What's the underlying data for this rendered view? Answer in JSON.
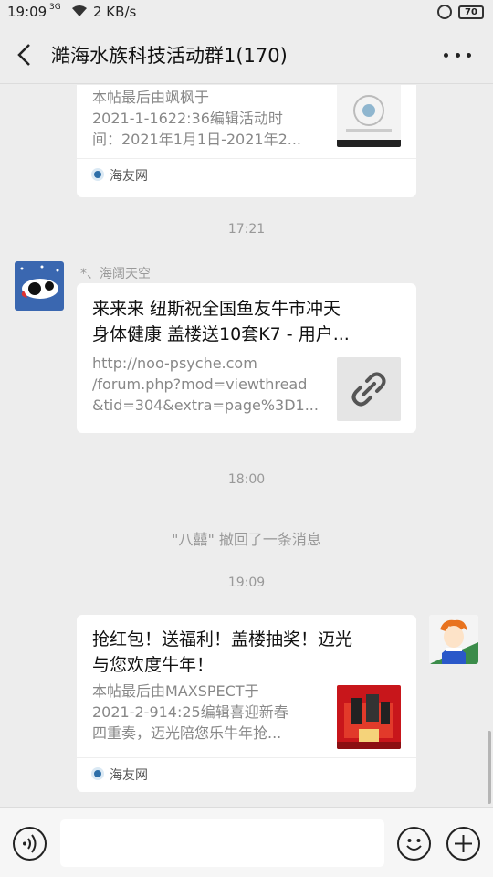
{
  "status_bar": {
    "time": "19:09",
    "signal": "3G",
    "net_speed": "2 KB/s",
    "battery": "70"
  },
  "header": {
    "title": "澔海水族科技活动群1(170)",
    "back_icon": "back-chevron-icon",
    "more_icon": "more-icon"
  },
  "messages": [
    {
      "type": "link-card",
      "desc": [
        "本帖最后由飒枫于",
        "2021-1-1622:36编辑活动时",
        "间：2021年1月1日-2021年2..."
      ],
      "source": "海友网"
    },
    {
      "type": "timestamp",
      "text": "17:21"
    },
    {
      "type": "link-card",
      "sender": "*、海阔天空",
      "title": [
        "来来来 纽斯祝全国鱼友牛市冲天",
        "身体健康 盖楼送10套K7 - 用户..."
      ],
      "desc": [
        "http://noo-psyche.com",
        "/forum.php?mod=viewthread",
        "&tid=304&extra=page%3D1..."
      ],
      "thumb_icon": "link-icon"
    },
    {
      "type": "timestamp",
      "text": "18:00"
    },
    {
      "type": "recall",
      "text": "\"八囍\" 撤回了一条消息"
    },
    {
      "type": "timestamp",
      "text": "19:09"
    },
    {
      "type": "link-card",
      "title": [
        "抢红包！送福利！盖楼抽奖！迈光",
        "与您欢度牛年！"
      ],
      "desc": [
        "本帖最后由MAXSPECT于",
        "2021-2-914:25编辑喜迎新春",
        "四重奏，迈光陪您乐牛年抢..."
      ],
      "source": "海友网"
    }
  ],
  "input_bar": {
    "voice_icon": "voice-icon",
    "emoji_icon": "emoji-icon",
    "plus_icon": "plus-icon"
  },
  "colors": {
    "background": "#ededed",
    "card": "#ffffff",
    "timestamp_text": "#999999",
    "source_logo": "#2d6ea8"
  }
}
